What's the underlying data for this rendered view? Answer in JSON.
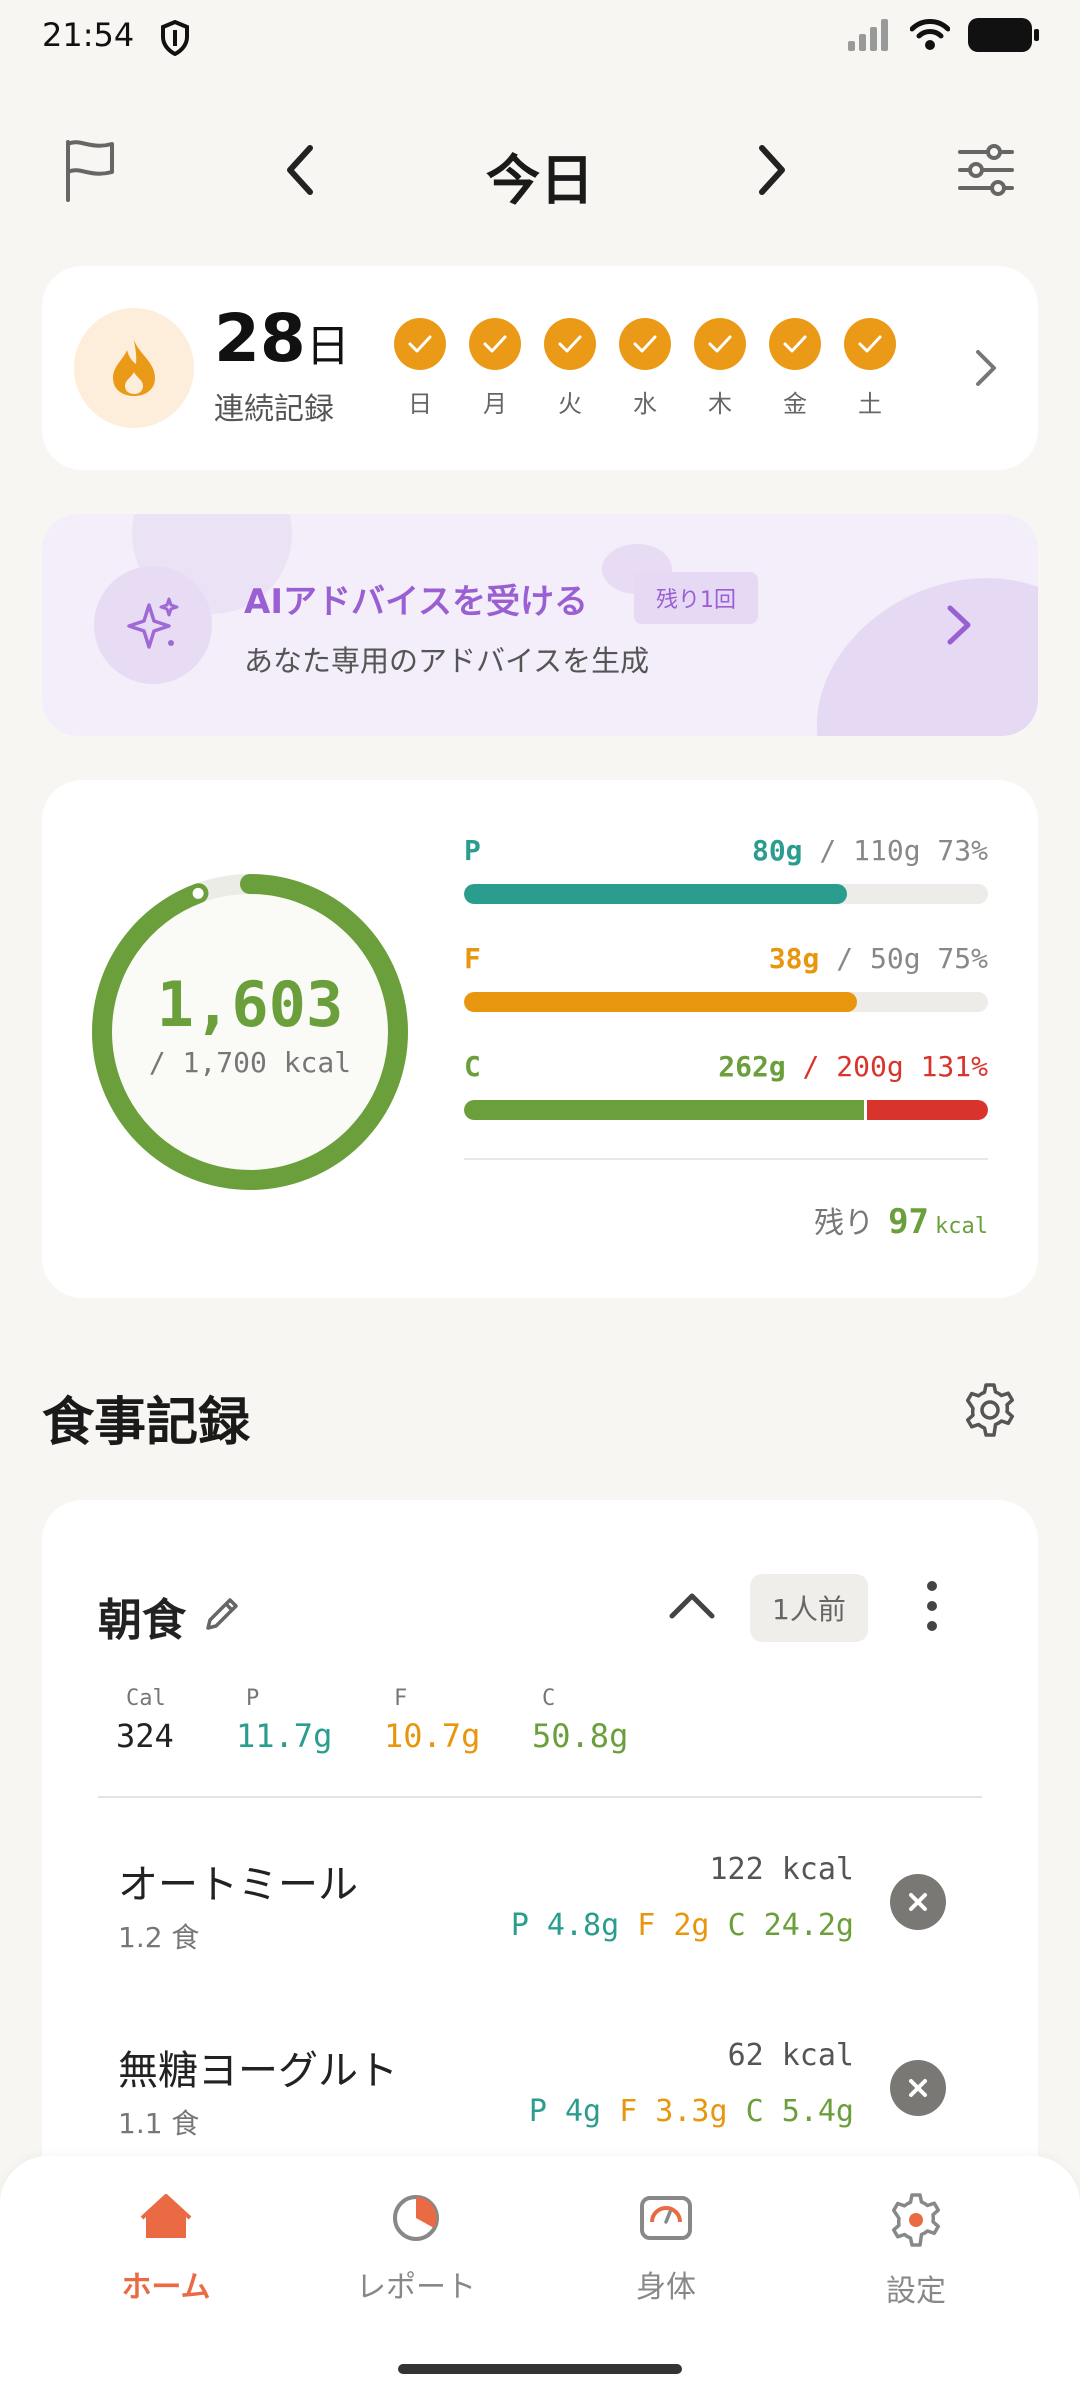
{
  "status": {
    "time": "21:54"
  },
  "header": {
    "title": "今日"
  },
  "streak": {
    "count": "28",
    "unit": "日",
    "label": "連続記録",
    "days": [
      "日",
      "月",
      "火",
      "水",
      "木",
      "金",
      "土"
    ]
  },
  "ai": {
    "title": "AIアドバイスを受ける",
    "badge": "残り1回",
    "subtitle": "あなた専用のアドバイスを生成"
  },
  "nutrition": {
    "calories": "1,603",
    "calories_goal": "/ 1,700 kcal",
    "calories_fraction": 0.943,
    "macros": [
      {
        "name": "P",
        "value": "80g",
        "goal": "/ 110g",
        "pct": "73%",
        "fill": 0.73,
        "color": "#2a9d8f"
      },
      {
        "name": "F",
        "value": "38g",
        "goal": "/ 50g",
        "pct": "75%",
        "fill": 0.75,
        "color": "#e9960f"
      },
      {
        "name": "C",
        "value": "262g",
        "goal": "/ 200g",
        "pct": "131%",
        "fill": 1.31,
        "color": "#6a9f3b",
        "over_color": "#d9342b"
      }
    ],
    "remaining_label": "残り",
    "remaining_value": "97",
    "remaining_unit": "kcal"
  },
  "meals_section": {
    "title": "食事記録"
  },
  "meal": {
    "name": "朝食",
    "serving": "1人前",
    "stats": [
      {
        "h": "Cal",
        "v": "324",
        "color": "#222222"
      },
      {
        "h": "P",
        "v": "11.7g",
        "color": "#2a9d8f"
      },
      {
        "h": "F",
        "v": "10.7g",
        "color": "#e9960f"
      },
      {
        "h": "C",
        "v": "50.8g",
        "color": "#6a9f3b"
      }
    ],
    "items": [
      {
        "name": "オートミール",
        "qty": "1.2 食",
        "kcal": "122 kcal",
        "p": "P 4.8g",
        "f": "F 2g",
        "c": "C 24.2g"
      },
      {
        "name": "無糖ヨーグルト",
        "qty": "1.1 食",
        "kcal": "62 kcal",
        "p": "P 4g",
        "f": "F 3.3g",
        "c": "C 5.4g"
      }
    ]
  },
  "nav": [
    {
      "label": "ホーム",
      "icon": "home-icon",
      "active": true
    },
    {
      "label": "レポート",
      "icon": "report-icon",
      "active": false
    },
    {
      "label": "身体",
      "icon": "scale-icon",
      "active": false
    },
    {
      "label": "設定",
      "icon": "settings-icon",
      "active": false
    }
  ]
}
